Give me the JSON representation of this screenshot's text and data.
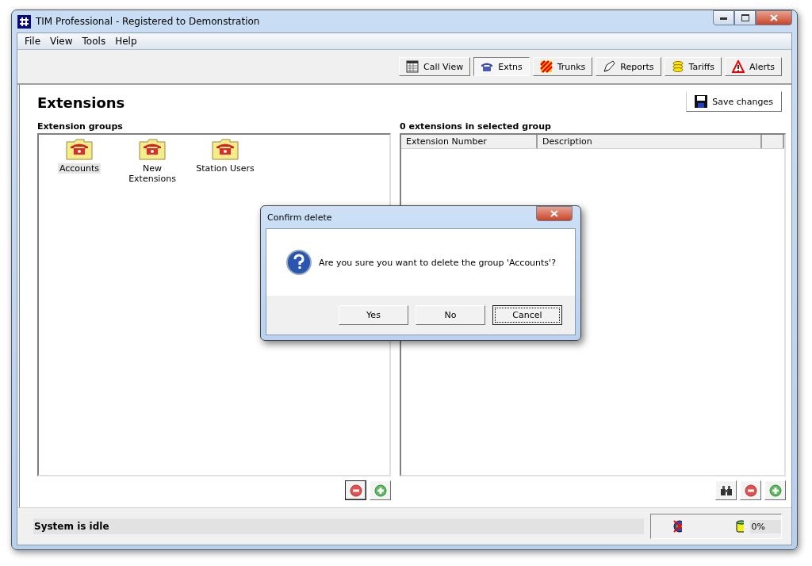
{
  "window": {
    "title": "TIM Professional - Registered to Demonstration"
  },
  "menu": [
    "File",
    "View",
    "Tools",
    "Help"
  ],
  "toolbar": [
    {
      "label": "Call View",
      "kind": "grid",
      "selected": false
    },
    {
      "label": "Extns",
      "kind": "phone",
      "selected": true
    },
    {
      "label": "Trunks",
      "kind": "stripes",
      "selected": false
    },
    {
      "label": "Reports",
      "kind": "pen",
      "selected": false
    },
    {
      "label": "Tariffs",
      "kind": "coins",
      "selected": false
    },
    {
      "label": "Alerts",
      "kind": "warning",
      "selected": false
    }
  ],
  "page": {
    "title": "Extensions",
    "save_button": "Save changes"
  },
  "groups": {
    "label": "Extension groups",
    "items": [
      {
        "label": "Accounts",
        "selected": true
      },
      {
        "label": "New Extensions",
        "selected": false
      },
      {
        "label": "Station Users",
        "selected": false
      }
    ],
    "actions": [
      {
        "kind": "remove",
        "focused": true
      },
      {
        "kind": "add",
        "focused": false
      }
    ]
  },
  "extensions": {
    "label": "0 extensions in selected group",
    "columns": [
      "Extension Number",
      "Description"
    ],
    "actions": [
      {
        "kind": "find",
        "focused": false
      },
      {
        "kind": "remove",
        "focused": false
      },
      {
        "kind": "add",
        "focused": false
      }
    ]
  },
  "status_bar": {
    "message": "System is idle",
    "usage": "0%"
  },
  "dialog": {
    "title": "Confirm delete",
    "message": "Are you sure you want to delete the group 'Accounts'?",
    "buttons": [
      {
        "label": "Yes",
        "default": false
      },
      {
        "label": "No",
        "default": false
      },
      {
        "label": "Cancel",
        "default": true
      }
    ]
  }
}
